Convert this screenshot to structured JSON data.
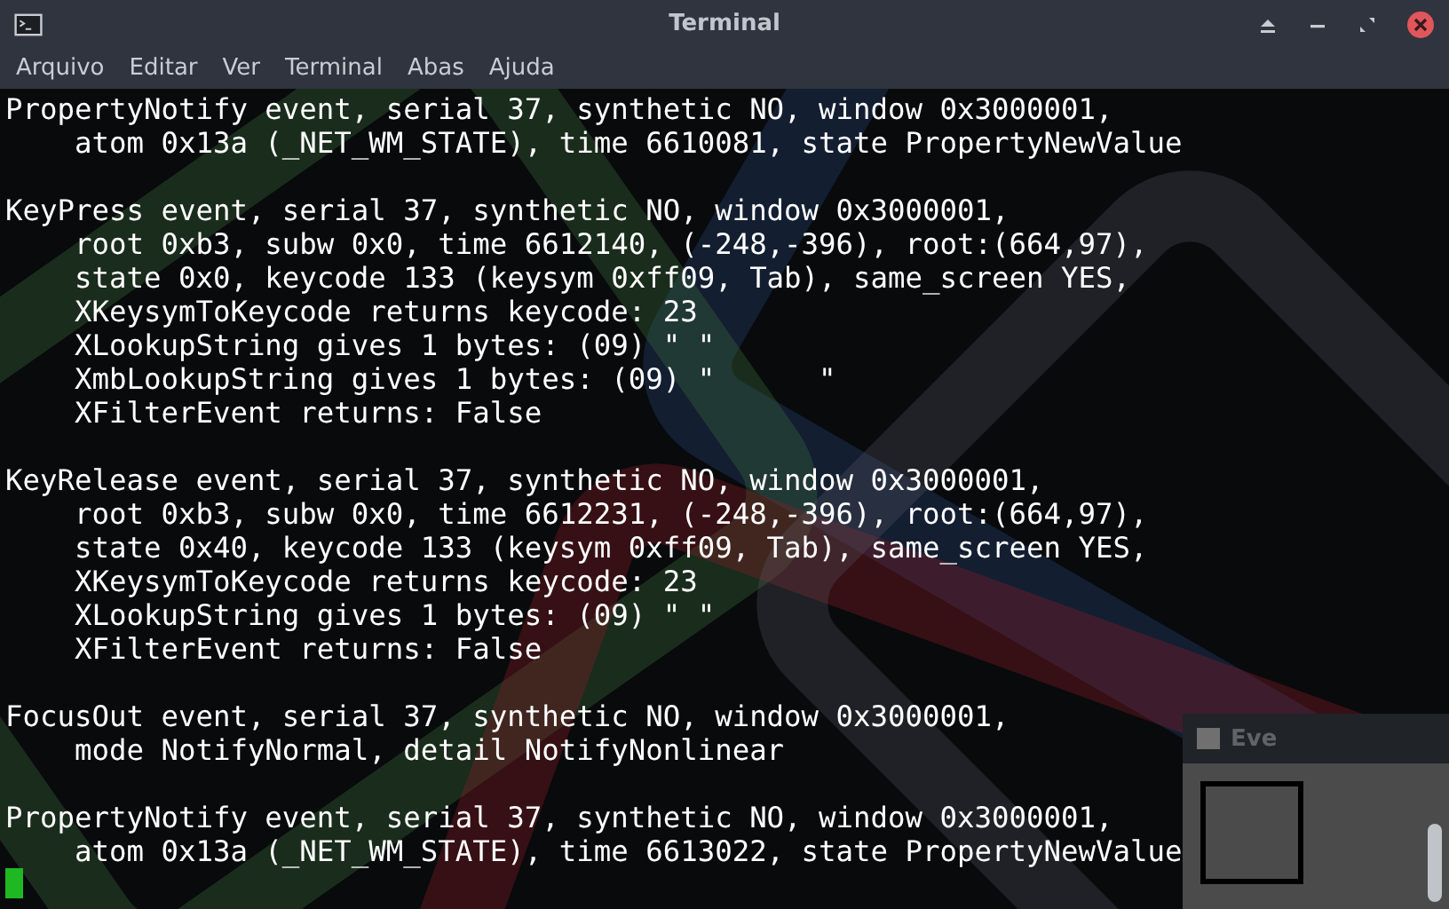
{
  "window": {
    "title": "Terminal"
  },
  "menu": [
    "Arquivo",
    "Editar",
    "Ver",
    "Terminal",
    "Abas",
    "Ajuda"
  ],
  "terminal": {
    "blocks": [
      [
        "PropertyNotify event, serial 37, synthetic NO, window 0x3000001,",
        "    atom 0x13a (_NET_WM_STATE), time 6610081, state PropertyNewValue"
      ],
      [
        "KeyPress event, serial 37, synthetic NO, window 0x3000001,",
        "    root 0xb3, subw 0x0, time 6612140, (-248,-396), root:(664,97),",
        "    state 0x0, keycode 133 (keysym 0xff09, Tab), same_screen YES,",
        "    XKeysymToKeycode returns keycode: 23",
        "    XLookupString gives 1 bytes: (09) \" \"",
        "    XmbLookupString gives 1 bytes: (09) \"      \"",
        "    XFilterEvent returns: False"
      ],
      [
        "KeyRelease event, serial 37, synthetic NO, window 0x3000001,",
        "    root 0xb3, subw 0x0, time 6612231, (-248,-396), root:(664,97),",
        "    state 0x40, keycode 133 (keysym 0xff09, Tab), same_screen YES,",
        "    XKeysymToKeycode returns keycode: 23",
        "    XLookupString gives 1 bytes: (09) \" \"",
        "    XFilterEvent returns: False"
      ],
      [
        "FocusOut event, serial 37, synthetic NO, window 0x3000001,",
        "    mode NotifyNormal, detail NotifyNonlinear"
      ],
      [
        "PropertyNotify event, serial 37, synthetic NO, window 0x3000001,",
        "    atom 0x13a (_NET_WM_STATE), time 6613022, state PropertyNewValue"
      ]
    ]
  },
  "background_window": {
    "title": "Eve"
  }
}
